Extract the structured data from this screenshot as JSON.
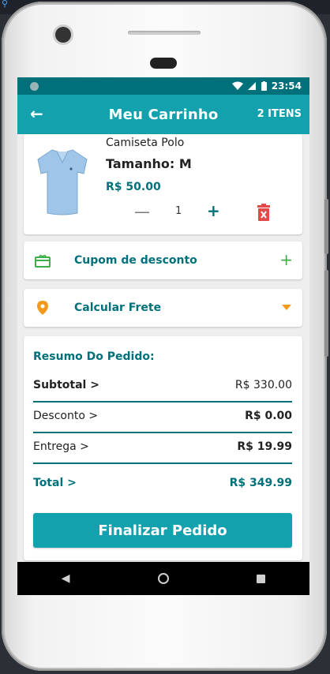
{
  "app": {
    "title": "Meu Carrinho",
    "item_count": "2 ITENS"
  },
  "status": {
    "time": "23:54"
  },
  "product": {
    "name": "Camiseta Polo",
    "size": "Tamanho: M",
    "price": "R$ 50.00",
    "quantity": "1",
    "minus": "—",
    "plus": "+"
  },
  "coupon": {
    "label": "Cupom de desconto",
    "action": "+"
  },
  "shipping": {
    "label": "Calcular Frete"
  },
  "summary": {
    "title": "Resumo Do Pedido:",
    "subtotal_label": "Subtotal >",
    "subtotal_value": "R$ 330.00",
    "discount_label": "Desconto >",
    "discount_value": "R$ 0.00",
    "delivery_label": "Entrega >",
    "delivery_value": "R$ 19.99",
    "total_label": "Total >",
    "total_value": "R$ 349.99"
  },
  "actions": {
    "finish_label": "Finalizar Pedido"
  },
  "colors": {
    "primary": "#13a1ad",
    "primary_dark": "#00717a",
    "danger": "#e24a4a",
    "accent_orange": "#f39a1d",
    "success_green": "#3fae49"
  },
  "icons": {
    "back": "arrow-left-icon",
    "trash": "trash-icon",
    "coupon": "gift-card-icon",
    "shipping": "location-pin-icon",
    "dropdown": "caret-down-icon"
  }
}
